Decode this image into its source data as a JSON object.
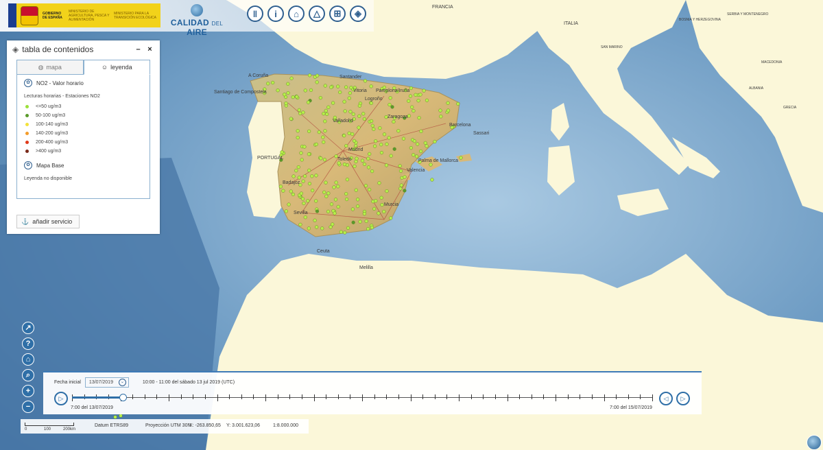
{
  "header": {
    "gov_line1": "GOBIERNO DE ESPAÑA",
    "ministry1": "MINISTERIO DE AGRICULTURA, PESCA Y ALIMENTACIÓN",
    "ministry2": "MINISTERIO PARA LA TRANSICIÓN ECOLÓGICA",
    "app_title_main": "CALIDAD",
    "app_title_del": "DEL",
    "app_title_end": "AIRE",
    "toolbar": [
      {
        "name": "measure-icon",
        "glyph": "‖"
      },
      {
        "name": "info-icon",
        "glyph": "i"
      },
      {
        "name": "bookmark-icon",
        "glyph": "⌂"
      },
      {
        "name": "area-icon",
        "glyph": "△"
      },
      {
        "name": "network-icon",
        "glyph": "⊞"
      },
      {
        "name": "layers-icon",
        "glyph": "◈"
      }
    ]
  },
  "toc": {
    "title": "tabla de contenidos",
    "minimize": "–",
    "close": "×",
    "tabs": [
      {
        "label": "mapa",
        "active": false
      },
      {
        "label": "leyenda",
        "active": true
      }
    ],
    "layer1_title": "NO2 - Valor horario",
    "legend_subtitle": "Lecturas horarias - Estaciones NO2",
    "legend_items": [
      {
        "label": "<=50 ug/m3",
        "color": "#9be03a"
      },
      {
        "label": "50-100 ug/m3",
        "color": "#5a9a2a"
      },
      {
        "label": "100-140 ug/m3",
        "color": "#f3e23a"
      },
      {
        "label": "140-200 ug/m3",
        "color": "#f39c2a"
      },
      {
        "label": "200-400 ug/m3",
        "color": "#e03a1a"
      },
      {
        "label": ">400 ug/m3",
        "color": "#7a2a1a"
      }
    ],
    "layer2_title": "Mapa Base",
    "no_legend": "Leyenda no disponible",
    "add_service": "añadir servicio"
  },
  "nav_buttons": [
    {
      "name": "share-icon",
      "glyph": "↗"
    },
    {
      "name": "help-icon",
      "glyph": "?"
    },
    {
      "name": "home-icon",
      "glyph": "⌂"
    },
    {
      "name": "zoom-search-icon",
      "glyph": "⌕"
    },
    {
      "name": "zoom-in-icon",
      "glyph": "+"
    },
    {
      "name": "zoom-out-icon",
      "glyph": "−"
    }
  ],
  "timeline": {
    "start_label": "Fecha inicial",
    "start_date": "13/07/2019",
    "range_text": "10:00 - 11:00 del sábado 13 jul 2019 (UTC)",
    "left_label": "7:00 del 13/07/2019",
    "right_label": "7:00 del 15/07/2019",
    "tick_count": 48,
    "current_position": 0.088
  },
  "status": {
    "scale_0": "0",
    "scale_100": "100",
    "scale_200": "200km",
    "datum": "Datum ETRS89",
    "projection": "Proyección UTM 30N",
    "x": "X: -263.850,65",
    "y": "Y: 3.001.623,06",
    "scale": "1:8.000.000"
  },
  "map_labels": {
    "countries": [
      "FRANCIA",
      "PORTUGAL",
      "ITALIA",
      "BOSNIA Y HERZEGOVINA",
      "SERBIA Y MONTENEGRO",
      "MACEDONIA",
      "ALBANIA",
      "GRECIA",
      "SAN MARINO"
    ],
    "cities": [
      "A Coruña",
      "Santander",
      "Santiago de Compostela",
      "Vitoria",
      "Pamplona/Iruña",
      "Logroño",
      "Valladolid",
      "Barcelona",
      "Zaragoza",
      "Madrid",
      "Toledo",
      "Badajoz",
      "Valencia",
      "Palma de Mallorca",
      "Sevilla",
      "Murcia",
      "Ceuta",
      "Melilla",
      "Sassari"
    ]
  },
  "colors": {
    "land_spain": "#d9c58f",
    "land_other": "#fbf7d9",
    "sea": "#7fa9c9",
    "accent": "#2f6fa7"
  }
}
